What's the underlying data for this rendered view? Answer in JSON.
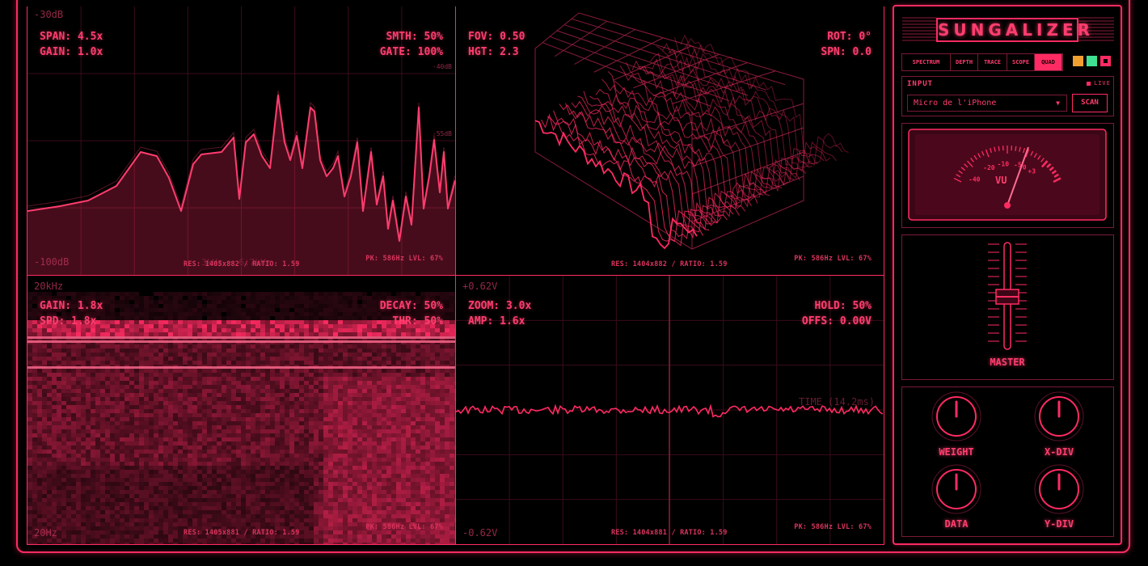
{
  "app": {
    "title": "SUNGALIZER"
  },
  "tabs": [
    {
      "label": "SPECTRUM",
      "active": false
    },
    {
      "label": "DEPTH",
      "active": false
    },
    {
      "label": "TRACE",
      "active": false
    },
    {
      "label": "SCOPE",
      "active": false
    },
    {
      "label": "QUAD",
      "active": true
    }
  ],
  "theme_swatches": [
    "#f0a030",
    "#40e090",
    "#ff2b62"
  ],
  "input": {
    "label": "INPUT",
    "live_label": "LIVE",
    "device": "Micro de l'iPhone",
    "scan_label": "SCAN"
  },
  "vu": {
    "label": "VU",
    "scale": [
      "-40",
      "-20",
      "-10",
      "-5",
      "0",
      "+3"
    ]
  },
  "fader": {
    "label": "MASTER"
  },
  "knobs": [
    {
      "label": "WEIGHT"
    },
    {
      "label": "X-DIV"
    },
    {
      "label": "DATA"
    },
    {
      "label": "Y-DIV"
    }
  ],
  "spectrum": {
    "axis_top": "-30dB",
    "axis_bottom": "-100dB",
    "axis_right_1": "-40dB",
    "axis_right_2": "-55dB",
    "axis_bottom_mid": "3kHz · 6.7kHz",
    "span": "SPAN: 4.5x",
    "gain": "GAIN: 1.0x",
    "smth": "SMTH: 50%",
    "gate": "GATE: 100%",
    "res": "RES: 1405x882 / RATIO: 1.59",
    "pk": "PK: 586Hz  LVL: 67%"
  },
  "depth": {
    "fov": "FOV: 0.50",
    "hgt": "HGT: 2.3",
    "rot": "ROT: 0°",
    "spn": "SPN: 0.0",
    "res": "RES: 1404x882 / RATIO: 1.59",
    "pk": "PK: 586Hz  LVL: 67%"
  },
  "trace": {
    "axis_top": "20kHz",
    "axis_bottom": "20Hz",
    "gain": "GAIN: 1.8x",
    "spd": "SPD: 1.8x",
    "decay": "DECAY: 50%",
    "thr": "THR: 50%",
    "res": "RES: 1405x881 / RATIO: 1.59",
    "pk": "PK: 586Hz  LVL: 67%"
  },
  "scope": {
    "axis_top": "+0.62V",
    "axis_bottom": "-0.62V",
    "zoom": "ZOOM: 3.0x",
    "amp": "AMP: 1.6x",
    "hold": "HOLD: 50%",
    "offs": "OFFS: 0.00V",
    "time": "TIME (14.2ms)",
    "res": "RES: 1404x881 / RATIO: 1.59",
    "pk": "PK: 586Hz  LVL: 67%"
  }
}
